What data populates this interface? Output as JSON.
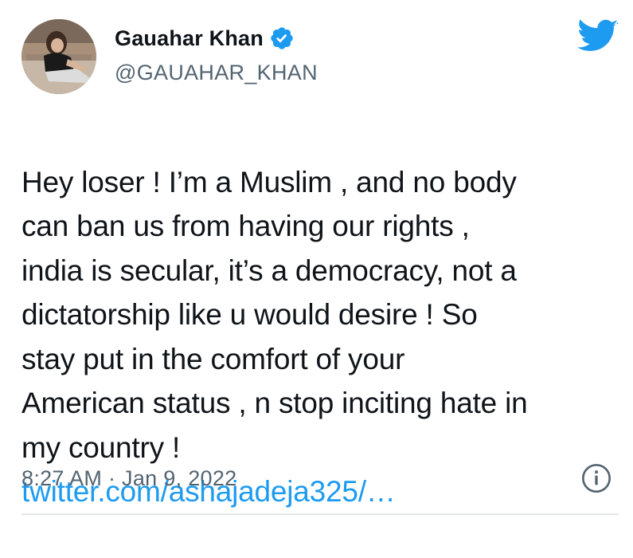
{
  "author": {
    "display_name": "Gauahar Khan",
    "handle": "@GAUAHAR_KHAN",
    "verified": true
  },
  "tweet": {
    "text": "Hey loser ! I’m a Muslim , and no body\ncan ban us from having our rights ,\nindia is secular, it’s a democracy, not a\ndictatorship like u would desire ! So\nstay put in the comfort of your\nAmerican status , n stop inciting hate in\nmy country !",
    "link": "twitter.com/ashajadeja325/…",
    "timestamp": "8:27 AM · Jan 9, 2022"
  },
  "icons": {
    "logo": "twitter-bird-icon",
    "verified": "verified-badge-icon",
    "info": "info-icon"
  },
  "colors": {
    "brand": "#1d9bf0",
    "text": "#0f1419",
    "secondary_text": "#536471",
    "divider": "#e1e8ed"
  }
}
